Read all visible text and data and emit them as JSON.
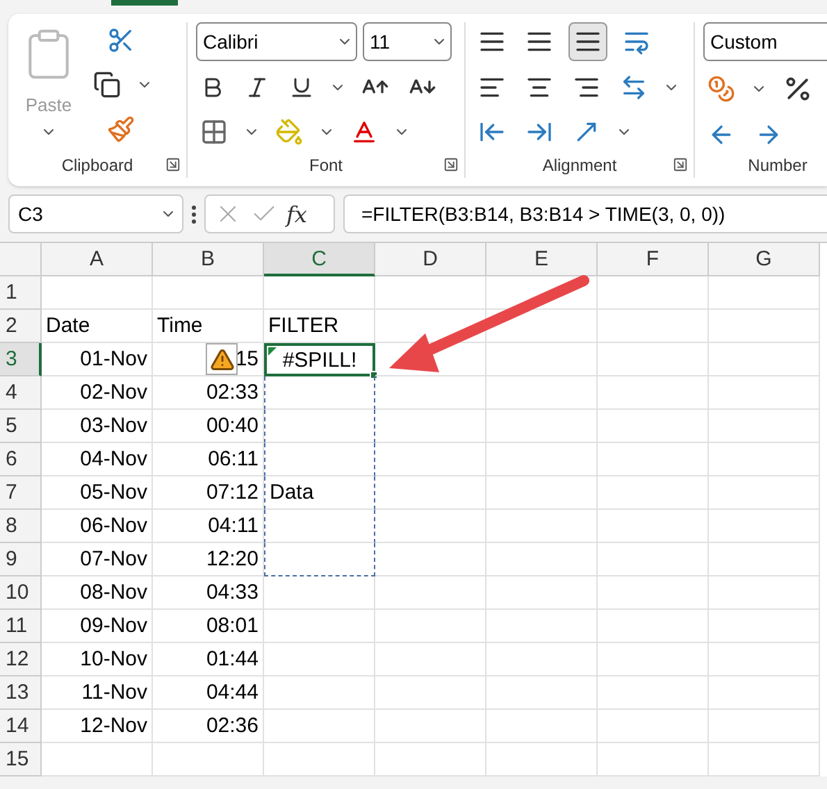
{
  "ribbon": {
    "paste_label": "Paste",
    "font_name": "Calibri",
    "font_size": "11",
    "number_format": "Custom",
    "groups": [
      "Clipboard",
      "Font",
      "Alignment",
      "Number"
    ]
  },
  "formula_bar": {
    "name_box": "C3",
    "fx": "fx",
    "formula": "=FILTER(B3:B14, B3:B14 > TIME(3, 0, 0))"
  },
  "columns": [
    {
      "label": "A",
      "selected": false
    },
    {
      "label": "B",
      "selected": false
    },
    {
      "label": "C",
      "selected": true
    },
    {
      "label": "D",
      "selected": false
    },
    {
      "label": "E",
      "selected": false
    },
    {
      "label": "F",
      "selected": false
    },
    {
      "label": "G",
      "selected": false
    }
  ],
  "rows": [
    {
      "header": "1",
      "selected": false,
      "in_spill": false
    },
    {
      "header": "2",
      "selected": false,
      "in_spill": false,
      "date": "Date",
      "time": "Time",
      "filter": "FILTER",
      "kind": "label"
    },
    {
      "header": "3",
      "selected": true,
      "in_spill": true,
      "date": "01-Nov",
      "time": "15",
      "warning": true,
      "filter": "#SPILL!",
      "kind": "data"
    },
    {
      "header": "4",
      "selected": false,
      "in_spill": true,
      "date": "02-Nov",
      "time": "02:33",
      "kind": "data"
    },
    {
      "header": "5",
      "selected": false,
      "in_spill": true,
      "date": "03-Nov",
      "time": "00:40",
      "kind": "data"
    },
    {
      "header": "6",
      "selected": false,
      "in_spill": true,
      "date": "04-Nov",
      "time": "06:11",
      "kind": "data"
    },
    {
      "header": "7",
      "selected": false,
      "in_spill": true,
      "date": "05-Nov",
      "time": "07:12",
      "filter": "Data",
      "kind": "data"
    },
    {
      "header": "8",
      "selected": false,
      "in_spill": true,
      "date": "06-Nov",
      "time": "04:11",
      "kind": "data"
    },
    {
      "header": "9",
      "selected": false,
      "in_spill": true,
      "date": "07-Nov",
      "time": "12:20",
      "kind": "data"
    },
    {
      "header": "10",
      "selected": false,
      "in_spill": false,
      "date": "08-Nov",
      "time": "04:33",
      "kind": "data"
    },
    {
      "header": "11",
      "selected": false,
      "in_spill": false,
      "date": "09-Nov",
      "time": "08:01",
      "kind": "data"
    },
    {
      "header": "12",
      "selected": false,
      "in_spill": false,
      "date": "10-Nov",
      "time": "01:44",
      "kind": "data"
    },
    {
      "header": "13",
      "selected": false,
      "in_spill": false,
      "date": "11-Nov",
      "time": "04:44",
      "kind": "data"
    },
    {
      "header": "14",
      "selected": false,
      "in_spill": false,
      "date": "12-Nov",
      "time": "02:36",
      "kind": "data"
    },
    {
      "header": "15",
      "selected": false,
      "in_spill": false
    }
  ]
}
